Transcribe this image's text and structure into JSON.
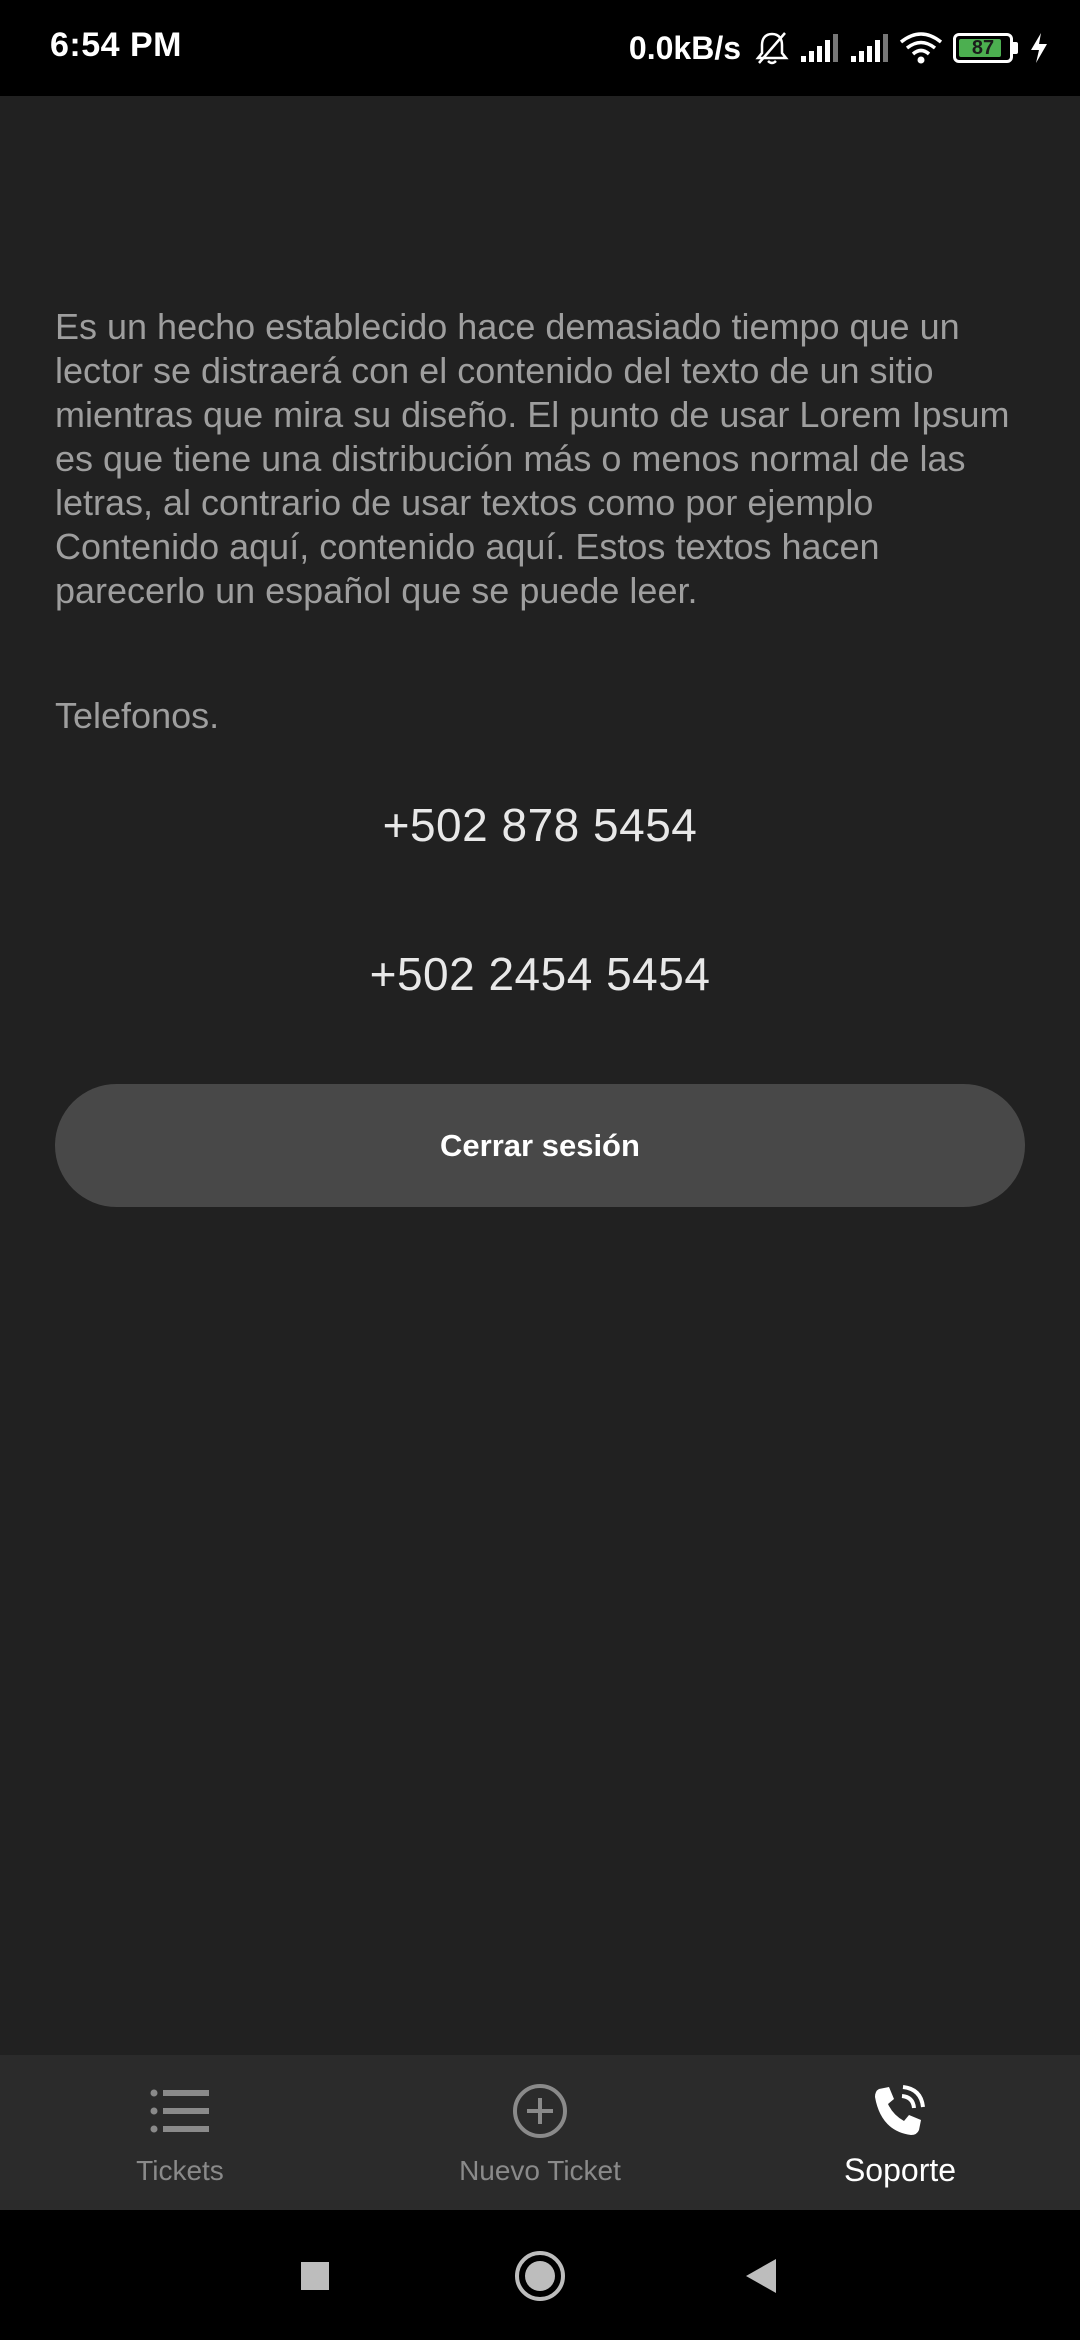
{
  "status_bar": {
    "time": "6:54 PM",
    "network_speed": "0.0kB/s",
    "battery_level": "87",
    "battery_fraction": 0.87,
    "icons": [
      "mute-bell-icon",
      "signal-icon",
      "signal-icon",
      "wifi-icon",
      "battery-icon",
      "charging-icon"
    ]
  },
  "main": {
    "description": "Es un hecho establecido hace demasiado tiempo que un lector se distraerá con el contenido del texto de un sitio mientras que mira su diseño. El punto de usar Lorem Ipsum es que tiene una distribución más o menos normal de las letras, al contrario de usar textos como por ejemplo Contenido aquí, contenido aquí. Estos textos hacen parecerlo un español que se puede leer.",
    "phones_label": "Telefonos.",
    "phones": [
      "+502 878 5454",
      "+502 2454 5454"
    ],
    "logout_label": "Cerrar sesión"
  },
  "bottom_nav": {
    "items": [
      {
        "label": "Tickets",
        "icon": "list-icon",
        "active": false
      },
      {
        "label": "Nuevo Ticket",
        "icon": "add-circle-icon",
        "active": false
      },
      {
        "label": "Soporte",
        "icon": "phone-call-icon",
        "active": true
      }
    ]
  },
  "system_nav": {
    "buttons": [
      "recent-apps-icon",
      "home-icon",
      "back-icon"
    ]
  },
  "colors": {
    "background": "#212121",
    "button": "#484848",
    "nav_background": "#2b2b2b",
    "text_muted": "#9e9e9e",
    "battery_fill": "#4caf50"
  }
}
